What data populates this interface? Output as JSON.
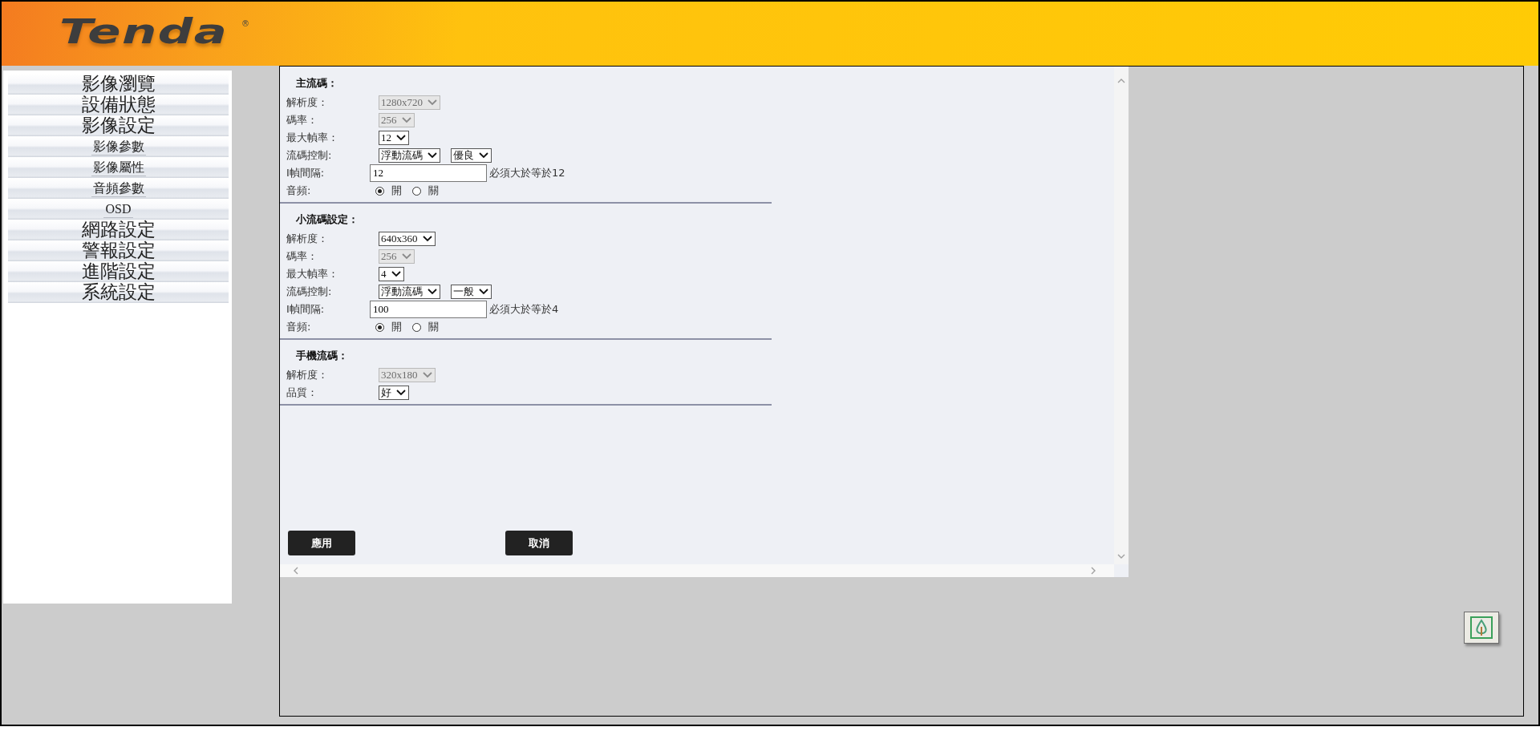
{
  "header": {
    "logo": "Tenda",
    "logo_mark": "®"
  },
  "sidebar": {
    "items": [
      {
        "label": "影像瀏覽"
      },
      {
        "label": "設備狀態"
      },
      {
        "label": "影像設定",
        "children": [
          {
            "label": "影像參數"
          },
          {
            "label": "影像屬性"
          },
          {
            "label": "音頻參數"
          },
          {
            "label": "OSD"
          }
        ]
      },
      {
        "label": "網路設定"
      },
      {
        "label": "警報設定"
      },
      {
        "label": "進階設定"
      },
      {
        "label": "系統設定"
      }
    ]
  },
  "sections": [
    {
      "title": "主流碼：",
      "rows": [
        {
          "label": "解析度：",
          "controls": [
            {
              "kind": "select",
              "value": "1280x720",
              "disabled": true
            }
          ]
        },
        {
          "label": "碼率：",
          "controls": [
            {
              "kind": "select",
              "value": "256",
              "disabled": true
            }
          ]
        },
        {
          "label": "最大幀率：",
          "controls": [
            {
              "kind": "select",
              "value": "12",
              "disabled": false
            }
          ]
        },
        {
          "label": "流碼控制:",
          "controls": [
            {
              "kind": "select",
              "value": "浮動流碼",
              "disabled": false
            },
            {
              "kind": "select",
              "value": "優良",
              "disabled": false
            }
          ]
        },
        {
          "label": "I幀間隔:",
          "controls": [
            {
              "kind": "text",
              "value": "12"
            },
            {
              "kind": "hint",
              "text": "必須大於等於12"
            }
          ]
        },
        {
          "label": "音頻:",
          "controls": [
            {
              "kind": "radio",
              "label": "開",
              "selected": true
            },
            {
              "kind": "radio",
              "label": "關",
              "selected": false
            }
          ]
        }
      ]
    },
    {
      "title": "小流碼設定：",
      "rows": [
        {
          "label": "解析度：",
          "controls": [
            {
              "kind": "select",
              "value": "640x360",
              "disabled": false
            }
          ]
        },
        {
          "label": "碼率：",
          "controls": [
            {
              "kind": "select",
              "value": "256",
              "disabled": true
            }
          ]
        },
        {
          "label": "最大幀率：",
          "controls": [
            {
              "kind": "select",
              "value": "4",
              "disabled": false
            }
          ]
        },
        {
          "label": "流碼控制:",
          "controls": [
            {
              "kind": "select",
              "value": "浮動流碼",
              "disabled": false
            },
            {
              "kind": "select",
              "value": "一般",
              "disabled": false
            }
          ]
        },
        {
          "label": "I幀間隔:",
          "controls": [
            {
              "kind": "text",
              "value": "100"
            },
            {
              "kind": "hint",
              "text": "必須大於等於4"
            }
          ]
        },
        {
          "label": "音頻:",
          "controls": [
            {
              "kind": "radio",
              "label": "開",
              "selected": true
            },
            {
              "kind": "radio",
              "label": "關",
              "selected": false
            }
          ]
        }
      ]
    },
    {
      "title": "手機流碼：",
      "rows": [
        {
          "label": "解析度：",
          "controls": [
            {
              "kind": "select",
              "value": "320x180",
              "disabled": true
            }
          ]
        },
        {
          "label": "品質：",
          "controls": [
            {
              "kind": "select",
              "value": "好",
              "disabled": false
            }
          ]
        }
      ]
    }
  ],
  "buttons": [
    {
      "label": "應用"
    },
    {
      "label": "取消"
    }
  ]
}
